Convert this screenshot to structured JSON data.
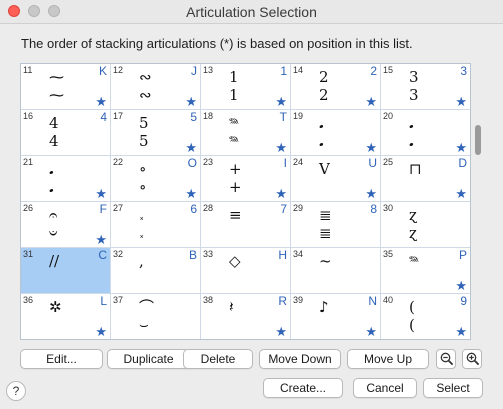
{
  "window": {
    "title": "Articulation Selection"
  },
  "instruction": "The order of stacking articulations (*) is based on position in this list.",
  "colors": {
    "selection": "#a8cdf4",
    "key": "#2f63b8",
    "close": "#fe5f57"
  },
  "cells": [
    {
      "num": "11",
      "key": "K",
      "star": "★",
      "above": "⁓",
      "below": "⁓",
      "sel": false
    },
    {
      "num": "12",
      "key": "J",
      "star": "★",
      "above": "∾",
      "below": "∾",
      "sel": false
    },
    {
      "num": "13",
      "key": "1",
      "star": "★",
      "above": "1",
      "below": "1",
      "sel": false
    },
    {
      "num": "14",
      "key": "2",
      "star": "★",
      "above": "2",
      "below": "2",
      "sel": false
    },
    {
      "num": "15",
      "key": "3",
      "star": "★",
      "above": "3",
      "below": "3",
      "sel": false
    },
    {
      "num": "16",
      "key": "4",
      "star": "",
      "above": "4",
      "below": "4",
      "sel": false
    },
    {
      "num": "17",
      "key": "5",
      "star": "★",
      "above": "5",
      "below": "5",
      "sel": false
    },
    {
      "num": "18",
      "key": "T",
      "star": "★",
      "above": "𝆮",
      "below": "𝆮",
      "sel": false
    },
    {
      "num": "19",
      "key": "",
      "star": "★",
      "above": "𝅘",
      "below": "𝅘",
      "sel": false
    },
    {
      "num": "20",
      "key": "",
      "star": "★",
      "above": "𝅘",
      "below": "𝅘",
      "sel": false
    },
    {
      "num": "21",
      "key": "",
      "star": "★",
      "above": "𝅘",
      "below": "𝅘",
      "sel": false
    },
    {
      "num": "22",
      "key": "O",
      "star": "★",
      "above": "∘",
      "below": "∘",
      "sel": false
    },
    {
      "num": "23",
      "key": "I",
      "star": "★",
      "above": "+",
      "below": "+",
      "sel": false
    },
    {
      "num": "24",
      "key": "U",
      "star": "★",
      "above": "V",
      "below": "",
      "sel": false
    },
    {
      "num": "25",
      "key": "D",
      "star": "★",
      "above": "⊓",
      "below": "",
      "sel": false
    },
    {
      "num": "26",
      "key": "F",
      "star": "★",
      "above": "𝄐",
      "below": "𝄑",
      "sel": false
    },
    {
      "num": "27",
      "key": "6",
      "star": "",
      "above": "𝅃",
      "below": "𝅃",
      "sel": false
    },
    {
      "num": "28",
      "key": "7",
      "star": "",
      "above": "≡",
      "below": "",
      "sel": false
    },
    {
      "num": "29",
      "key": "8",
      "star": "",
      "above": "≣",
      "below": "≣",
      "sel": false
    },
    {
      "num": "30",
      "key": "",
      "star": "",
      "above": "ɀ",
      "below": "ɀ",
      "sel": false
    },
    {
      "num": "31",
      "key": "C",
      "star": "",
      "above": "//",
      "below": "",
      "sel": true
    },
    {
      "num": "32",
      "key": "B",
      "star": "",
      "above": ",",
      "below": "",
      "sel": false
    },
    {
      "num": "33",
      "key": "H",
      "star": "",
      "above": "◇",
      "below": "",
      "sel": false
    },
    {
      "num": "34",
      "key": "",
      "star": "",
      "above": "~",
      "below": "",
      "sel": false
    },
    {
      "num": "35",
      "key": "P",
      "star": "★",
      "above": "𝆮",
      "below": "",
      "sel": false
    },
    {
      "num": "36",
      "key": "L",
      "star": "★",
      "above": "✲",
      "below": "",
      "sel": false
    },
    {
      "num": "37",
      "key": "",
      "star": "",
      "above": "⌒",
      "below": "⌣",
      "sel": false
    },
    {
      "num": "38",
      "key": "R",
      "star": "★",
      "above": "𝄽",
      "below": "",
      "sel": false
    },
    {
      "num": "39",
      "key": "N",
      "star": "★",
      "above": "♪",
      "below": "",
      "sel": false
    },
    {
      "num": "40",
      "key": "9",
      "star": "★",
      "above": "(",
      "below": "(",
      "sel": false
    }
  ],
  "buttons": {
    "edit": "Edit...",
    "duplicate": "Duplicate",
    "delete": "Delete",
    "move_down": "Move Down",
    "move_up": "Move Up",
    "create": "Create...",
    "cancel": "Cancel",
    "select": "Select",
    "help": "?"
  },
  "icons": {
    "zoom_out": "zoom-out-icon",
    "zoom_in": "zoom-in-icon"
  }
}
